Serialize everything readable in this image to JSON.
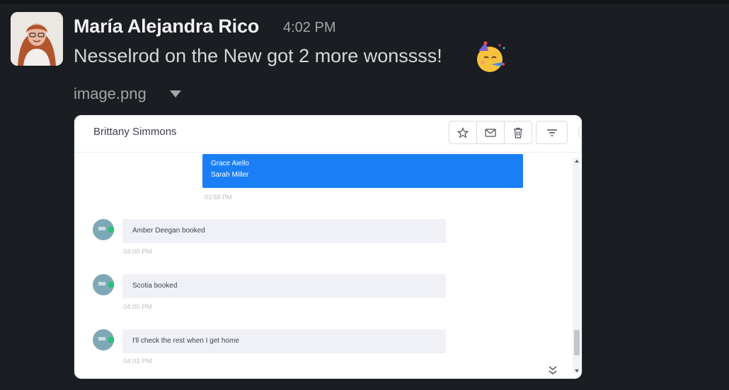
{
  "message": {
    "sender": "María Alejandra Rico",
    "time": "4:02 PM",
    "text": "Nesselrod on the New got 2 more wonssss!",
    "emoji": "partying-face",
    "attachment_name": "image.png"
  },
  "screenshot": {
    "contact_name": "Brittany Simmons",
    "toolbar": [
      "star-icon",
      "mail-icon",
      "trash-icon",
      "filter-icon"
    ],
    "outgoing": {
      "lines": [
        "Grace Aiello",
        "Sarah Miller"
      ],
      "time": "03:58 PM"
    },
    "incoming": [
      {
        "text": "Amber Deegan booked",
        "time": "04:00 PM"
      },
      {
        "text": "Scotia booked",
        "time": "04:00 PM"
      },
      {
        "text": "I'll check the rest when I get home",
        "time": "04:01 PM"
      }
    ]
  },
  "colors": {
    "background": "#1a1d21",
    "outgoing_bubble": "#1a7ff6",
    "incoming_bubble": "#f0f1f7",
    "online_dot": "#28c07c"
  }
}
